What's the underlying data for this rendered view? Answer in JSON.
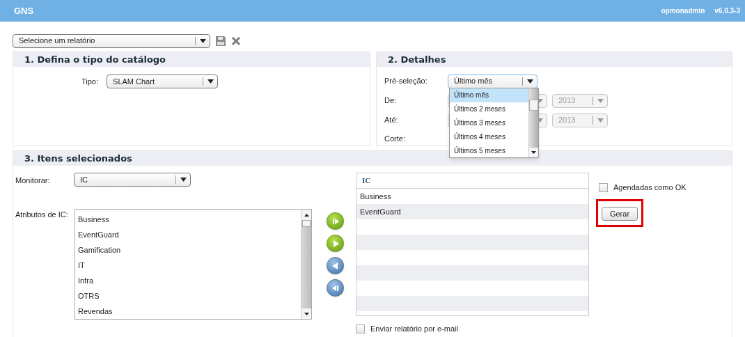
{
  "app": {
    "title": "GNS",
    "user": "opmonadmin",
    "version": "v6.0.3-3"
  },
  "report_select": {
    "value": "Selecione um relatório"
  },
  "section_1": {
    "title": "1. Defina o tipo do catálogo",
    "type_label": "Tipo:",
    "type_value": "SLAM Chart"
  },
  "section_2": {
    "title": "2. Detalhes",
    "preselection_label": "Pré-seleção:",
    "preselection_value": "Último mês",
    "expanded": true,
    "options": [
      {
        "label": "Último mês",
        "selected": true
      },
      {
        "label": "Últimos 2 meses",
        "selected": false
      },
      {
        "label": "Últimos 3 meses",
        "selected": false
      },
      {
        "label": "Últimos 4 meses",
        "selected": false
      },
      {
        "label": "Últimos 5 meses",
        "selected": false
      }
    ],
    "from": {
      "label": "De:",
      "year": "2013",
      "disabled": true
    },
    "to": {
      "label": "Até:",
      "year": "2013",
      "disabled": true
    },
    "cut_label": "Corte:"
  },
  "section_3": {
    "title": "3. Itens selecionados",
    "monitor_label": "Monitorar:",
    "monitor_value": "IC",
    "attributes_label": "Atributos de IC:",
    "attributes": [
      "Business",
      "EventGuard",
      "Gamification",
      "IT",
      "Infra",
      "OTRS",
      "Revendas"
    ],
    "selected_table": {
      "header": "IC",
      "rows": [
        "Business",
        "EventGuard"
      ]
    },
    "scheduled_ok": {
      "label": "Agendadas como OK",
      "checked": false
    },
    "generate_button": {
      "label": "Gerar",
      "highlighted": true
    },
    "email": {
      "label": "Enviar relatório por e-mail",
      "checked": false
    }
  }
}
